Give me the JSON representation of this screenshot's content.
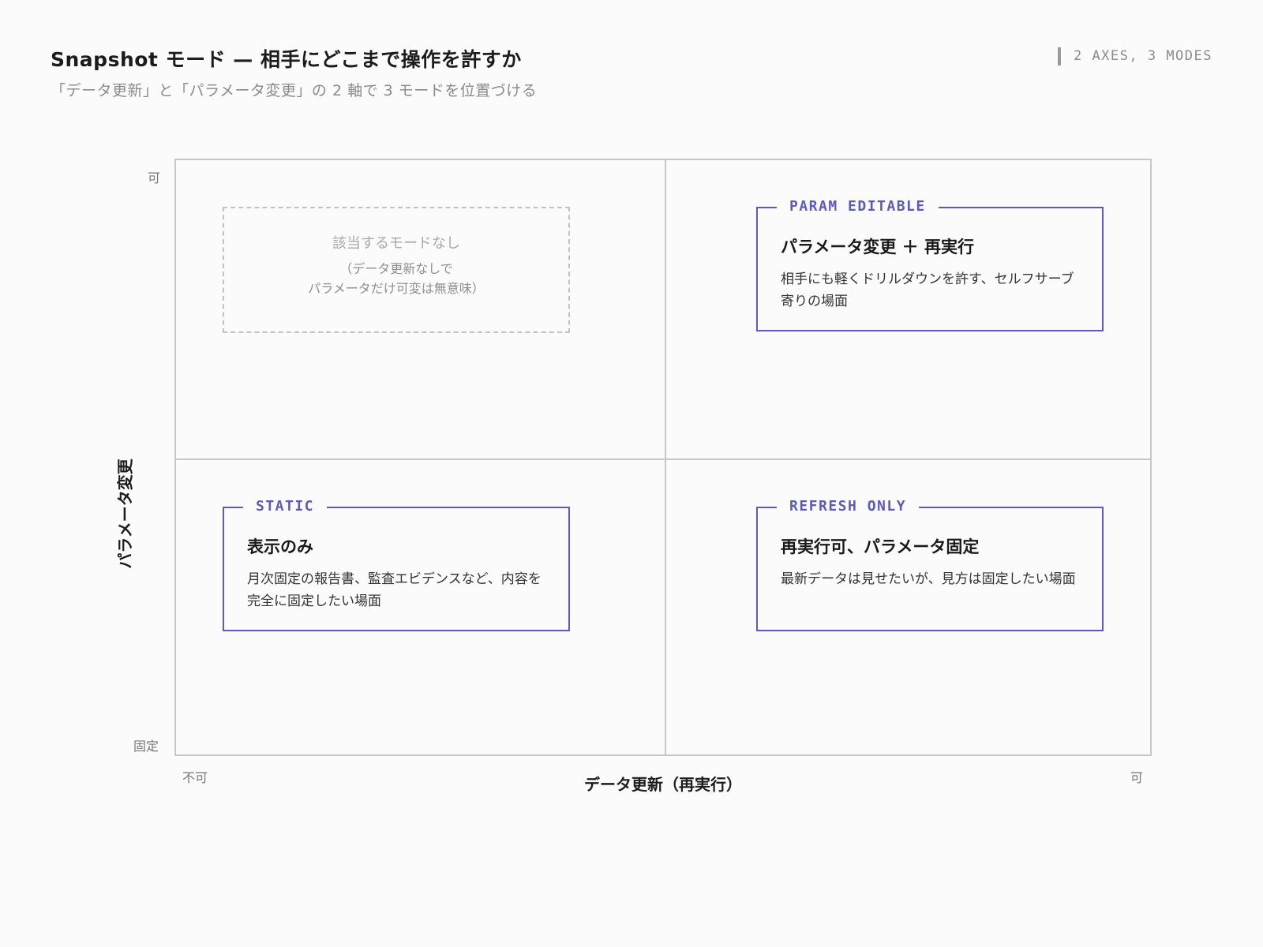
{
  "header": {
    "title": "Snapshot モード — 相手にどこまで操作を許すか",
    "subtitle": "「データ更新」と「パラメータ変更」の 2 軸で 3 モードを位置づける",
    "corner_tag": "2 AXES, 3 MODES"
  },
  "axes": {
    "x": {
      "title": "データ更新（再実行）",
      "low_label": "不可",
      "high_label": "可"
    },
    "y": {
      "title": "パラメータ変更",
      "low_label": "固定",
      "high_label": "可"
    }
  },
  "quadrants": {
    "top_left": {
      "title": "該当するモードなし",
      "note": "（データ更新なしで\nパラメータだけ可変は無意味）"
    },
    "top_right": {
      "tag": "PARAM EDITABLE",
      "heading": "パラメータ変更 ＋ 再実行",
      "body": "相手にも軽くドリルダウンを許す、セルフサーブ寄りの場面"
    },
    "bottom_left": {
      "tag": "STATIC",
      "heading": "表示のみ",
      "body": "月次固定の報告書、監査エビデンスなど、内容を完全に固定したい場面"
    },
    "bottom_right": {
      "tag": "REFRESH ONLY",
      "heading": "再実行可、パラメータ固定",
      "body": "最新データは見せたいが、見方は固定したい場面"
    }
  },
  "colors": {
    "accent": "#5b5bbf",
    "grid": "#c7c7c7",
    "background": "#fbfbfb"
  }
}
